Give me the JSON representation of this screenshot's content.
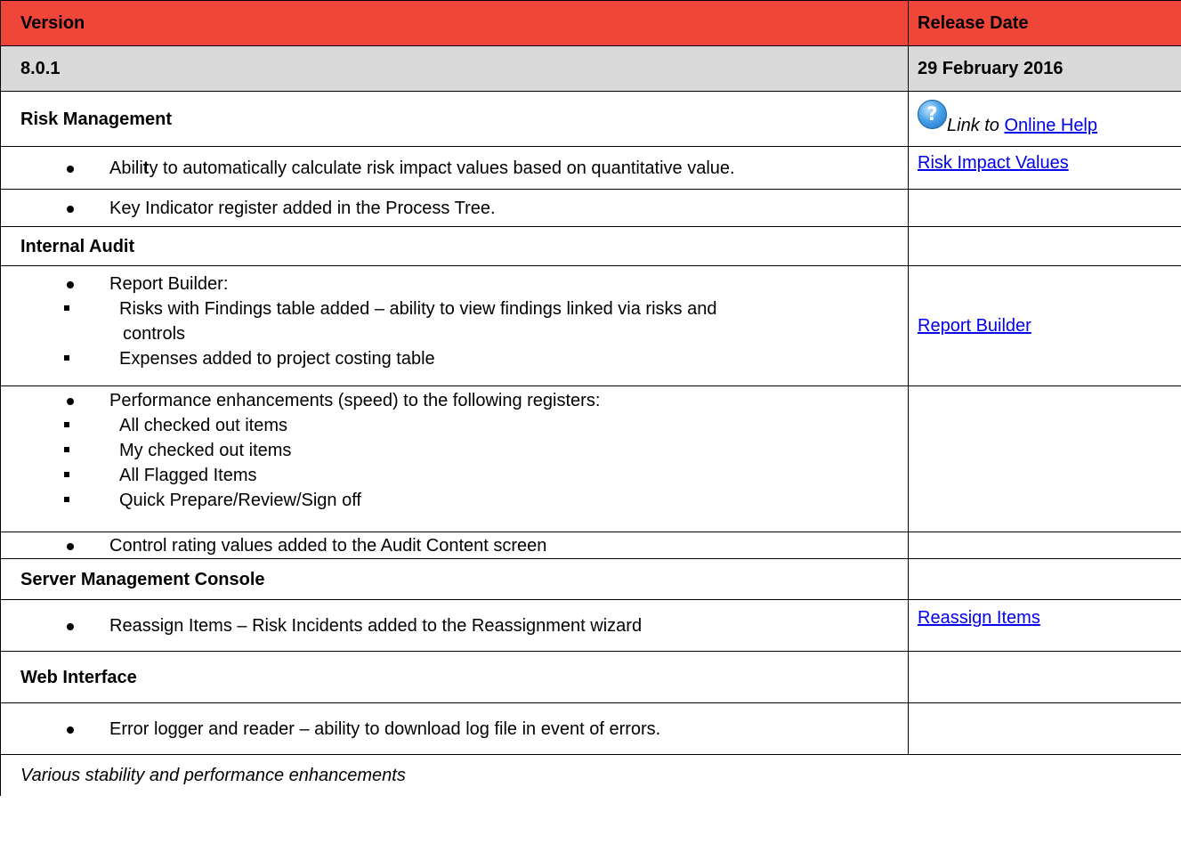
{
  "header": {
    "version_label": "Version",
    "release_date_label": "Release Date"
  },
  "version": {
    "number": "8.0.1",
    "date": "29 February 2016"
  },
  "help": {
    "icon": "help-question-icon",
    "prefix": "Link to",
    "link_text": "Online Help"
  },
  "sections": {
    "risk_management": {
      "title": "Risk Management",
      "items": [
        {
          "text_before": "Abili",
          "text_bold": "t",
          "text_after": "y to automatically calculate risk impact values based on quantitative value.",
          "link": "Risk Impact Values"
        },
        {
          "text": "Key Indicator register added in the Process Tree."
        }
      ]
    },
    "internal_audit": {
      "title": "Internal Audit",
      "report_builder": {
        "text": "Report Builder:",
        "sub_items": [
          {
            "line1": "Risks with Findings table added – ability to view findings linked via risks and",
            "line2": "controls"
          },
          {
            "line1": "Expenses added to project costing table"
          }
        ],
        "link": "Report Builder"
      },
      "performance": {
        "text": "Performance enhancements (speed) to the following registers:",
        "sub_items": [
          "All checked out items",
          "My checked out items",
          "All Flagged Items",
          "Quick Prepare/Review/Sign off"
        ]
      },
      "control_rating": {
        "text": "Control rating values added to the Audit Content screen"
      }
    },
    "server_console": {
      "title": "Server Management Console",
      "items": [
        {
          "text": "Reassign Items – Risk Incidents added to the Reassignment wizard",
          "link": "Reassign Items"
        }
      ]
    },
    "web_interface": {
      "title": "Web Interface",
      "items": [
        {
          "text": "Error logger and reader – ability to download log file in event of errors."
        }
      ]
    }
  },
  "footer": {
    "note": "Various stability and performance enhancements"
  },
  "colors": {
    "header_bg": "#f0463a",
    "version_bg": "#d9d9d9",
    "link": "#0000ee"
  }
}
